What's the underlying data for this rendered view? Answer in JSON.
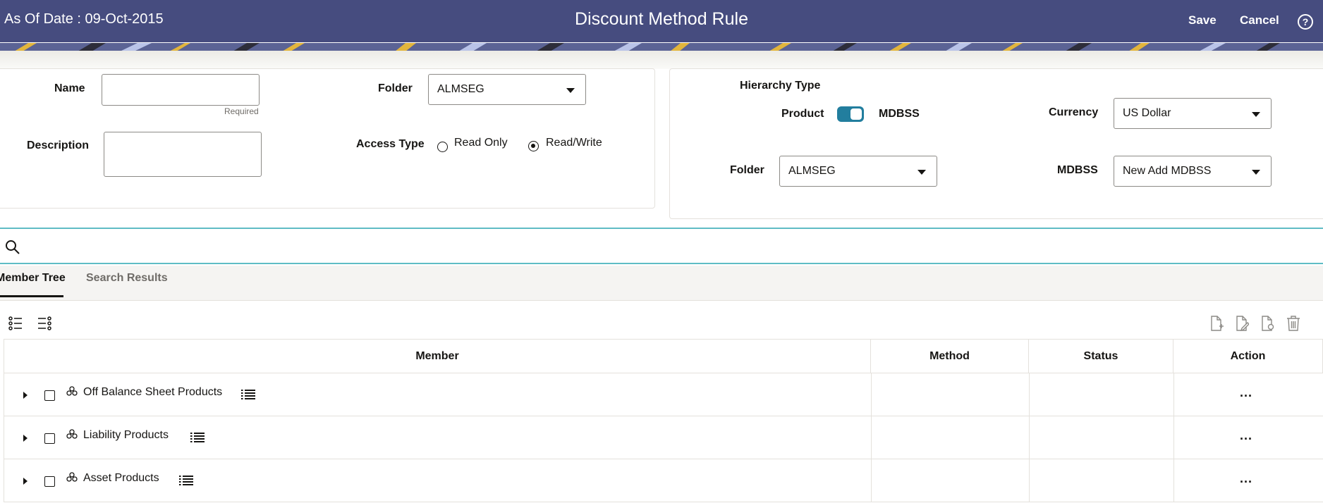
{
  "header": {
    "as_of": "As Of Date : 09-Oct-2015",
    "title": "Discount Method Rule",
    "save_label": "Save",
    "cancel_label": "Cancel",
    "help_glyph": "?"
  },
  "form": {
    "name_label": "Name",
    "name_value": "",
    "required_text": "Required",
    "description_label": "Description",
    "description_value": "",
    "folder_label": "Folder",
    "folder_value": "ALMSEG",
    "access_type_label": "Access Type",
    "access_options": [
      "Read Only",
      "Read/Write"
    ],
    "access_selected": "Read/Write"
  },
  "hierarchy": {
    "title": "Hierarchy Type",
    "toggle_left_label": "Product",
    "toggle_right_label": "MDBSS",
    "toggle_on": true,
    "currency_label": "Currency",
    "currency_value": "US Dollar",
    "folder_label": "Folder",
    "folder_value": "ALMSEG",
    "mdbss_label": "MDBSS",
    "mdbss_value": "New Add MDBSS"
  },
  "search": {
    "value": ""
  },
  "tabs": [
    {
      "label": "Member Tree",
      "active": true
    },
    {
      "label": "Search Results",
      "active": false
    }
  ],
  "toolbar": {
    "left_icons": [
      "expand-all-icon",
      "collapse-all-icon"
    ],
    "right_icons": [
      "add-document-icon",
      "edit-document-icon",
      "view-document-icon",
      "delete-icon"
    ]
  },
  "table": {
    "columns": [
      "Member",
      "Method",
      "Status",
      "Action"
    ],
    "rows": [
      {
        "member": "Off Balance Sheet Products",
        "method": "",
        "status": "",
        "action": "..."
      },
      {
        "member": "Liability Products",
        "method": "",
        "status": "",
        "action": "..."
      },
      {
        "member": "Asset Products",
        "method": "",
        "status": "",
        "action": "..."
      }
    ]
  },
  "colors": {
    "header_bg": "#464c7f",
    "accent_teal": "#5fbcc5",
    "toggle_on": "#227e9e"
  }
}
